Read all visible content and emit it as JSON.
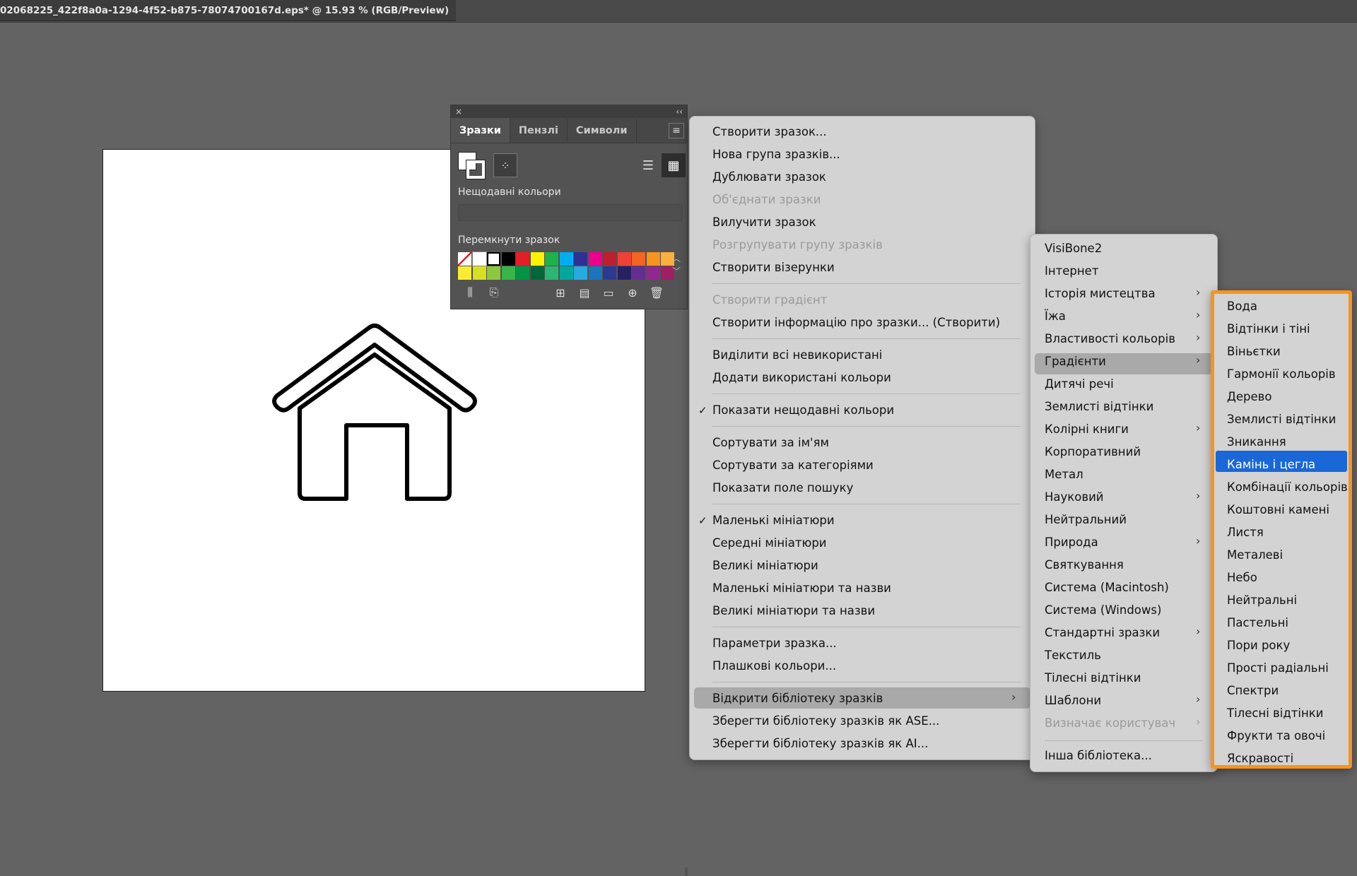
{
  "document_tab": "02068225_422f8a0a-1294-4f52-b875-78074700167d.eps* @ 15.93 % (RGB/Preview)",
  "panel": {
    "close": "×",
    "collapse": "‹‹",
    "tabs": [
      "Зразки",
      "Пензлі",
      "Символи"
    ],
    "recent_label": "Нещодавні кольори",
    "toggle_label": "Перемкнути зразок",
    "swatches_row1": [
      "#ffffff",
      "#ffffff",
      "#ffffff",
      "#000000",
      "#e21f26",
      "#fff200",
      "#1fb14a",
      "#00aeef",
      "#2e3192",
      "#ec008c",
      "#be1e2d",
      "#ef4136",
      "#f26522",
      "#f7941d",
      "#fbb040"
    ],
    "swatches_row2": [
      "#f9ed32",
      "#d7df23",
      "#8dc63f",
      "#39b54a",
      "#009444",
      "#006838",
      "#2bb673",
      "#00a79d",
      "#27aae1",
      "#1c75bc",
      "#2b3990",
      "#262262",
      "#662d91",
      "#92278f",
      "#9e1f63"
    ]
  },
  "menu1": {
    "items": [
      {
        "label": "Створити зразок...",
        "disabled": false
      },
      {
        "label": "Нова група зразків...",
        "disabled": false
      },
      {
        "label": "Дублювати зразок",
        "disabled": false
      },
      {
        "label": "Об'єднати зразки",
        "disabled": true
      },
      {
        "label": "Вилучити зразок",
        "disabled": false
      },
      {
        "label": "Розгрупувати групу зразків",
        "disabled": true
      },
      {
        "label": "Створити візерунки",
        "disabled": false
      },
      {
        "label": "Створити градієнт",
        "disabled": true
      },
      {
        "label": "Створити інформацію про зразки... (Створити)",
        "disabled": false
      },
      {
        "label": "Виділити всі невикористані",
        "disabled": false
      },
      {
        "label": "Додати використані кольори",
        "disabled": false
      },
      {
        "label": "Показати нещодавні кольори",
        "disabled": false,
        "checked": true
      },
      {
        "label": "Сортувати за ім'ям",
        "disabled": false
      },
      {
        "label": "Сортувати за категоріями",
        "disabled": false
      },
      {
        "label": "Показати поле пошуку",
        "disabled": false
      },
      {
        "label": "Маленькі мініатюри",
        "disabled": false,
        "checked": true
      },
      {
        "label": "Середні мініатюри",
        "disabled": false
      },
      {
        "label": "Великі мініатюри",
        "disabled": false
      },
      {
        "label": "Маленькі мініатюри та назви",
        "disabled": false
      },
      {
        "label": "Великі мініатюри та назви",
        "disabled": false
      },
      {
        "label": "Параметри зразка...",
        "disabled": false
      },
      {
        "label": "Плашкові кольори...",
        "disabled": false
      },
      {
        "label": "Відкрити бібліотеку зразків",
        "disabled": false,
        "submenu": true,
        "highlighted": true
      },
      {
        "label": "Зберегти бібліотеку зразків як ASE...",
        "disabled": false
      },
      {
        "label": "Зберегти бібліотеку зразків як AI...",
        "disabled": false
      }
    ],
    "check_glyph": "✓",
    "arrow_glyph": "›"
  },
  "menu2": {
    "items": [
      {
        "label": "VisiBone2"
      },
      {
        "label": "Інтернет"
      },
      {
        "label": "Історія мистецтва",
        "submenu": true
      },
      {
        "label": "Їжа",
        "submenu": true
      },
      {
        "label": "Властивості кольорів",
        "submenu": true
      },
      {
        "label": "Градієнти",
        "submenu": true,
        "highlighted": true
      },
      {
        "label": "Дитячі речі"
      },
      {
        "label": "Землисті відтінки"
      },
      {
        "label": "Колірні книги",
        "submenu": true
      },
      {
        "label": "Корпоративний"
      },
      {
        "label": "Метал"
      },
      {
        "label": "Науковий",
        "submenu": true
      },
      {
        "label": "Нейтральний"
      },
      {
        "label": "Природа",
        "submenu": true
      },
      {
        "label": "Святкування"
      },
      {
        "label": "Система (Macintosh)"
      },
      {
        "label": "Система (Windows)"
      },
      {
        "label": "Стандартні зразки",
        "submenu": true
      },
      {
        "label": "Текстиль"
      },
      {
        "label": "Тілесні відтінки"
      },
      {
        "label": "Шаблони",
        "submenu": true
      },
      {
        "label": "Визначає користувач",
        "submenu": true,
        "disabled": true
      },
      {
        "label": "Інша бібліотека..."
      }
    ]
  },
  "menu3": {
    "items": [
      {
        "label": "Вода"
      },
      {
        "label": "Відтінки і тіні"
      },
      {
        "label": "Віньєтки"
      },
      {
        "label": "Гармонії кольорів"
      },
      {
        "label": "Дерево"
      },
      {
        "label": "Землисті відтінки"
      },
      {
        "label": "Зникання"
      },
      {
        "label": "Камінь і цегла",
        "highlighted": true
      },
      {
        "label": "Комбінації кольорів"
      },
      {
        "label": "Коштовні камені"
      },
      {
        "label": "Листя"
      },
      {
        "label": "Металеві"
      },
      {
        "label": "Небо"
      },
      {
        "label": "Нейтральні"
      },
      {
        "label": "Пастельні"
      },
      {
        "label": "Пори року"
      },
      {
        "label": "Прості радіальні"
      },
      {
        "label": "Спектри"
      },
      {
        "label": "Тілесні відтінки"
      },
      {
        "label": "Фрукти та овочі"
      },
      {
        "label": "Яскравості"
      }
    ]
  },
  "colors": {
    "highlight_blue": "#1a68d8",
    "highlight_grey": "#a9a9a9",
    "callout_orange": "#f7931e"
  }
}
